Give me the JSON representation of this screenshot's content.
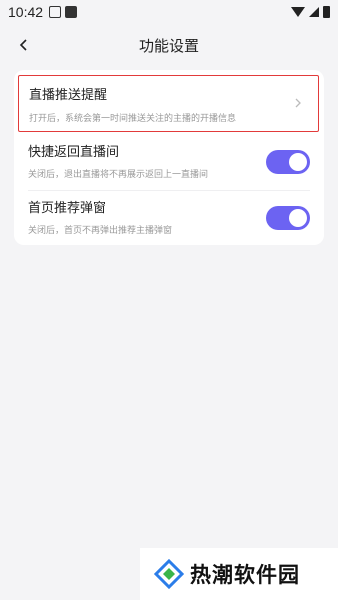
{
  "status_bar": {
    "time": "10:42",
    "icons": [
      "notification-icon",
      "square-icon",
      "wifi-icon",
      "signal-icon",
      "battery-icon"
    ]
  },
  "header": {
    "title": "功能设置",
    "back_icon": "back-chevron-icon"
  },
  "settings": {
    "items": [
      {
        "title": "直播推送提醒",
        "description": "打开后，系统会第一时间推送关注的主播的开播信息",
        "control": "chevron",
        "highlighted": true
      },
      {
        "title": "快捷返回直播间",
        "description": "关闭后，退出直播将不再展示返回上一直播间",
        "control": "toggle",
        "enabled": true
      },
      {
        "title": "首页推荐弹窗",
        "description": "关闭后，首页不再弹出推荐主播弹窗",
        "control": "toggle",
        "enabled": true
      }
    ]
  },
  "watermark": {
    "text": "热潮软件园"
  },
  "colors": {
    "accent": "#6c63f2",
    "highlight_border": "#e23a3a",
    "background": "#f4f4f6"
  }
}
